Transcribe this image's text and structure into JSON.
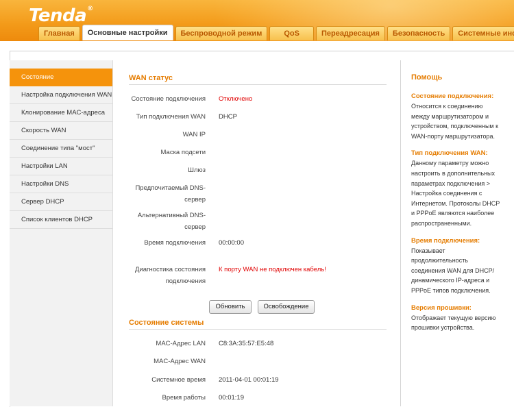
{
  "logo": {
    "text": "Tenda",
    "reg": "®"
  },
  "tabs": [
    {
      "label": "Главная",
      "active": false
    },
    {
      "label": "Основные настройки",
      "active": true
    },
    {
      "label": "Беспроводной режим",
      "active": false
    },
    {
      "label": "QoS",
      "active": false
    },
    {
      "label": "Переадресация",
      "active": false
    },
    {
      "label": "Безопасность",
      "active": false
    },
    {
      "label": "Системные инструменты",
      "active": false
    }
  ],
  "sidebar": {
    "items": [
      {
        "label": "Состояние",
        "active": true
      },
      {
        "label": "Настройка подключения WAN"
      },
      {
        "label": "Клонирование MAC-адреса"
      },
      {
        "label": "Скорость WAN"
      },
      {
        "label": "Соединение типа \"мост\""
      },
      {
        "label": "Настройки LAN"
      },
      {
        "label": "Настройки DNS"
      },
      {
        "label": "Сервер DHCP"
      },
      {
        "label": "Список клиентов DHCP"
      }
    ]
  },
  "wan": {
    "title": "WAN статус",
    "connection_state_label": "Состояние подключения",
    "connection_state_value": "Отключено",
    "connection_type_label": "Тип подключения WAN",
    "connection_type_value": "DHCP",
    "wan_ip_label": "WAN IP",
    "wan_ip_value": "",
    "subnet_label": "Маска подсети",
    "subnet_value": "",
    "gateway_label": "Шлюз",
    "gateway_value": "",
    "dns1_label_1": "Предпочитаемый DNS-",
    "dns1_label_2": "сервер",
    "dns1_value": "",
    "dns2_label_1": "Альтернативный DNS-",
    "dns2_label_2": "сервер",
    "dns2_value": "",
    "uptime_label": "Время подключения",
    "uptime_value": "00:00:00",
    "diag_label_1": "Диагностика состояния",
    "diag_label_2": "подключения",
    "diag_value": "К порту WAN не подключен кабель!",
    "refresh_button": "Обновить",
    "release_button": "Освобождение"
  },
  "system": {
    "title": "Состояние системы",
    "lan_mac_label": "MAC-Адрес LAN",
    "lan_mac_value": "C8:3A:35:57:E5:48",
    "wan_mac_label": "MAC-Адрес WAN",
    "wan_mac_value": "",
    "sys_time_label": "Системное время",
    "sys_time_value": "2011-04-01 00:01:19",
    "uptime_label": "Время работы",
    "uptime_value": "00:01:19"
  },
  "help": {
    "title": "Помощь",
    "sections": [
      {
        "heading": "Состояние подключения:",
        "text": "Относится к соединению между маршрутизатором и устройством, подключенным к WAN-порту маршрутизатора."
      },
      {
        "heading": "Тип подключения WAN:",
        "text": "Данному параметру можно настроить в дополнительных параметрах подключения > Настройка соединения с Интернетом. Протоколы DHCP и PPPoE являются наиболее распространенными."
      },
      {
        "heading": "Время подключения:",
        "text": "Показывает продолжительность соединения WAN для DHCP/динамического IP-адреса и PPPoE типов подключения."
      },
      {
        "heading": "Версия прошивки:",
        "text": "Отображает текущую версию прошивки устройства."
      }
    ]
  },
  "colors": {
    "accent": "#f5930c",
    "heading": "#e57c00",
    "error": "#e00000"
  }
}
